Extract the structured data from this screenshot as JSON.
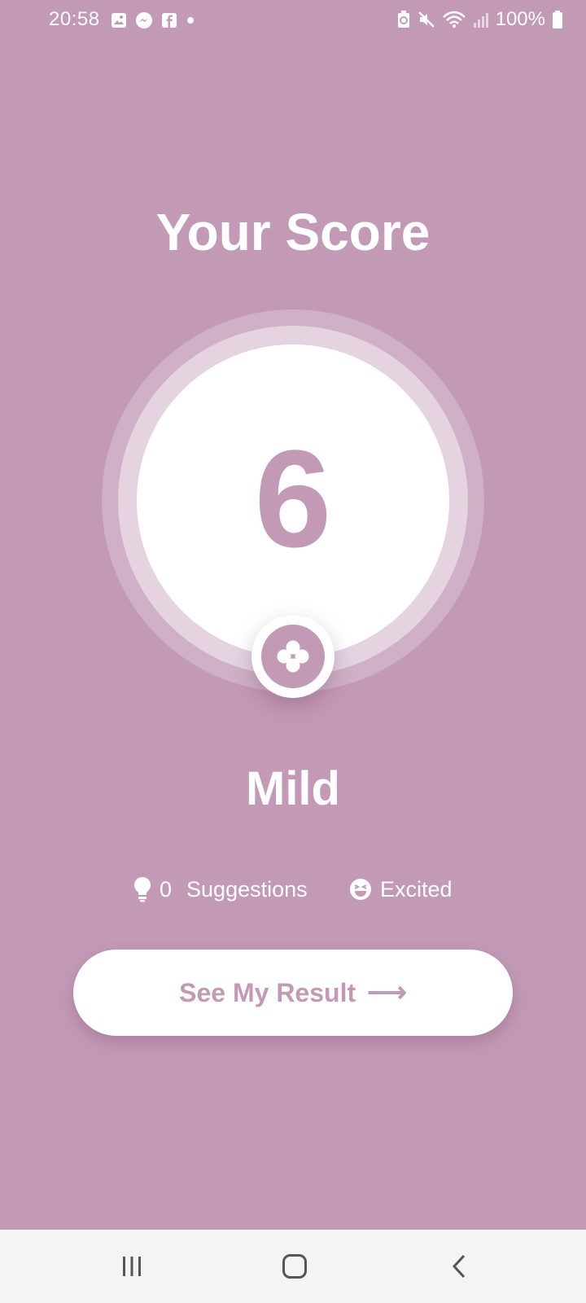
{
  "status": {
    "time": "20:58",
    "battery": "100%",
    "left_icons": [
      "gallery-icon",
      "messenger-icon",
      "facebook-icon",
      "dot-icon"
    ],
    "right_icons": [
      "battery-saver-icon",
      "mute-icon",
      "wifi-icon",
      "signal-icon",
      "battery-icon"
    ]
  },
  "title": "Your Score",
  "score": {
    "value": "6",
    "level": "Mild",
    "badge_icon": "game-dots-icon"
  },
  "meta": {
    "suggestions_count": "0",
    "suggestions_label": "Suggestions",
    "mood": "Excited"
  },
  "cta": {
    "label": "See My Result",
    "arrow": "⟶"
  },
  "colors": {
    "background": "#c29ab6",
    "accent": "#c29ab6",
    "text": "#ffffff"
  }
}
